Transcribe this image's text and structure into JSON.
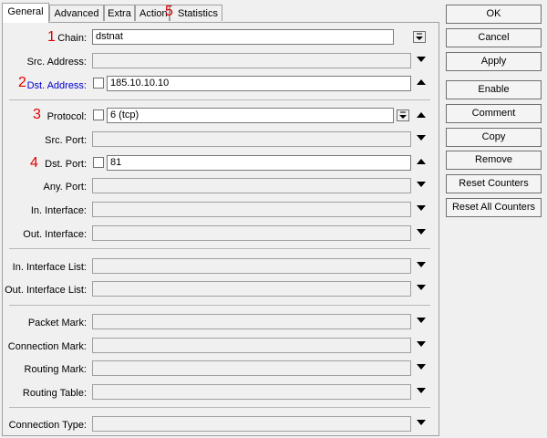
{
  "tabs": [
    "General",
    "Advanced",
    "Extra",
    "Action",
    "Statistics"
  ],
  "fields": {
    "chain": {
      "label": "Chain:",
      "value": "dstnat"
    },
    "src_address": {
      "label": "Src. Address:"
    },
    "dst_address": {
      "label": "Dst. Address:",
      "value": "185.10.10.10"
    },
    "protocol": {
      "label": "Protocol:",
      "value": "6 (tcp)"
    },
    "src_port": {
      "label": "Src. Port:"
    },
    "dst_port": {
      "label": "Dst. Port:",
      "value": "81"
    },
    "any_port": {
      "label": "Any. Port:"
    },
    "in_interface": {
      "label": "In. Interface:"
    },
    "out_interface": {
      "label": "Out. Interface:"
    },
    "in_interface_list": {
      "label": "In. Interface List:"
    },
    "out_interface_list": {
      "label": "Out. Interface List:"
    },
    "packet_mark": {
      "label": "Packet Mark:"
    },
    "connection_mark": {
      "label": "Connection Mark:"
    },
    "routing_mark": {
      "label": "Routing Mark:"
    },
    "routing_table": {
      "label": "Routing Table:"
    },
    "connection_type": {
      "label": "Connection Type:"
    }
  },
  "annotations": [
    "1",
    "2",
    "3",
    "4",
    "5"
  ],
  "buttons": [
    "OK",
    "Cancel",
    "Apply",
    "Enable",
    "Comment",
    "Copy",
    "Remove",
    "Reset Counters",
    "Reset All Counters"
  ],
  "colors": {
    "annotation": "#e00000",
    "highlight_label": "#0000d0"
  }
}
